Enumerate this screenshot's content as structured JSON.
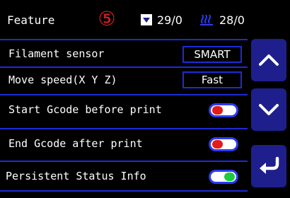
{
  "header": {
    "title": "Feature",
    "step_marker": "⑤",
    "nozzle_temp": "29/0",
    "bed_temp": "28/0",
    "nozzle_icon": "nozzle-icon",
    "bed_icon": "heated-bed-icon"
  },
  "settings": [
    {
      "label": "Filament sensor",
      "type": "badge",
      "value": "SMART"
    },
    {
      "label": "Move speed(X  Y  Z)",
      "type": "badge",
      "value": "Fast"
    },
    {
      "label": "Start Gcode before print",
      "type": "toggle",
      "state": "off"
    },
    {
      "label": "End Gcode after print",
      "type": "toggle",
      "state": "off"
    },
    {
      "label": "Persistent Status Info",
      "type": "toggle",
      "state": "on"
    }
  ],
  "nav": {
    "up_icon": "chevron-up-icon",
    "down_icon": "chevron-down-icon",
    "back_icon": "back-arrow-icon"
  },
  "colors": {
    "accent_blue": "#1c2bd8",
    "nav_bg": "#1e1f8c",
    "toggle_off": "#e41b1b",
    "toggle_on": "#1dcc3b",
    "marker_red": "#e02020"
  }
}
